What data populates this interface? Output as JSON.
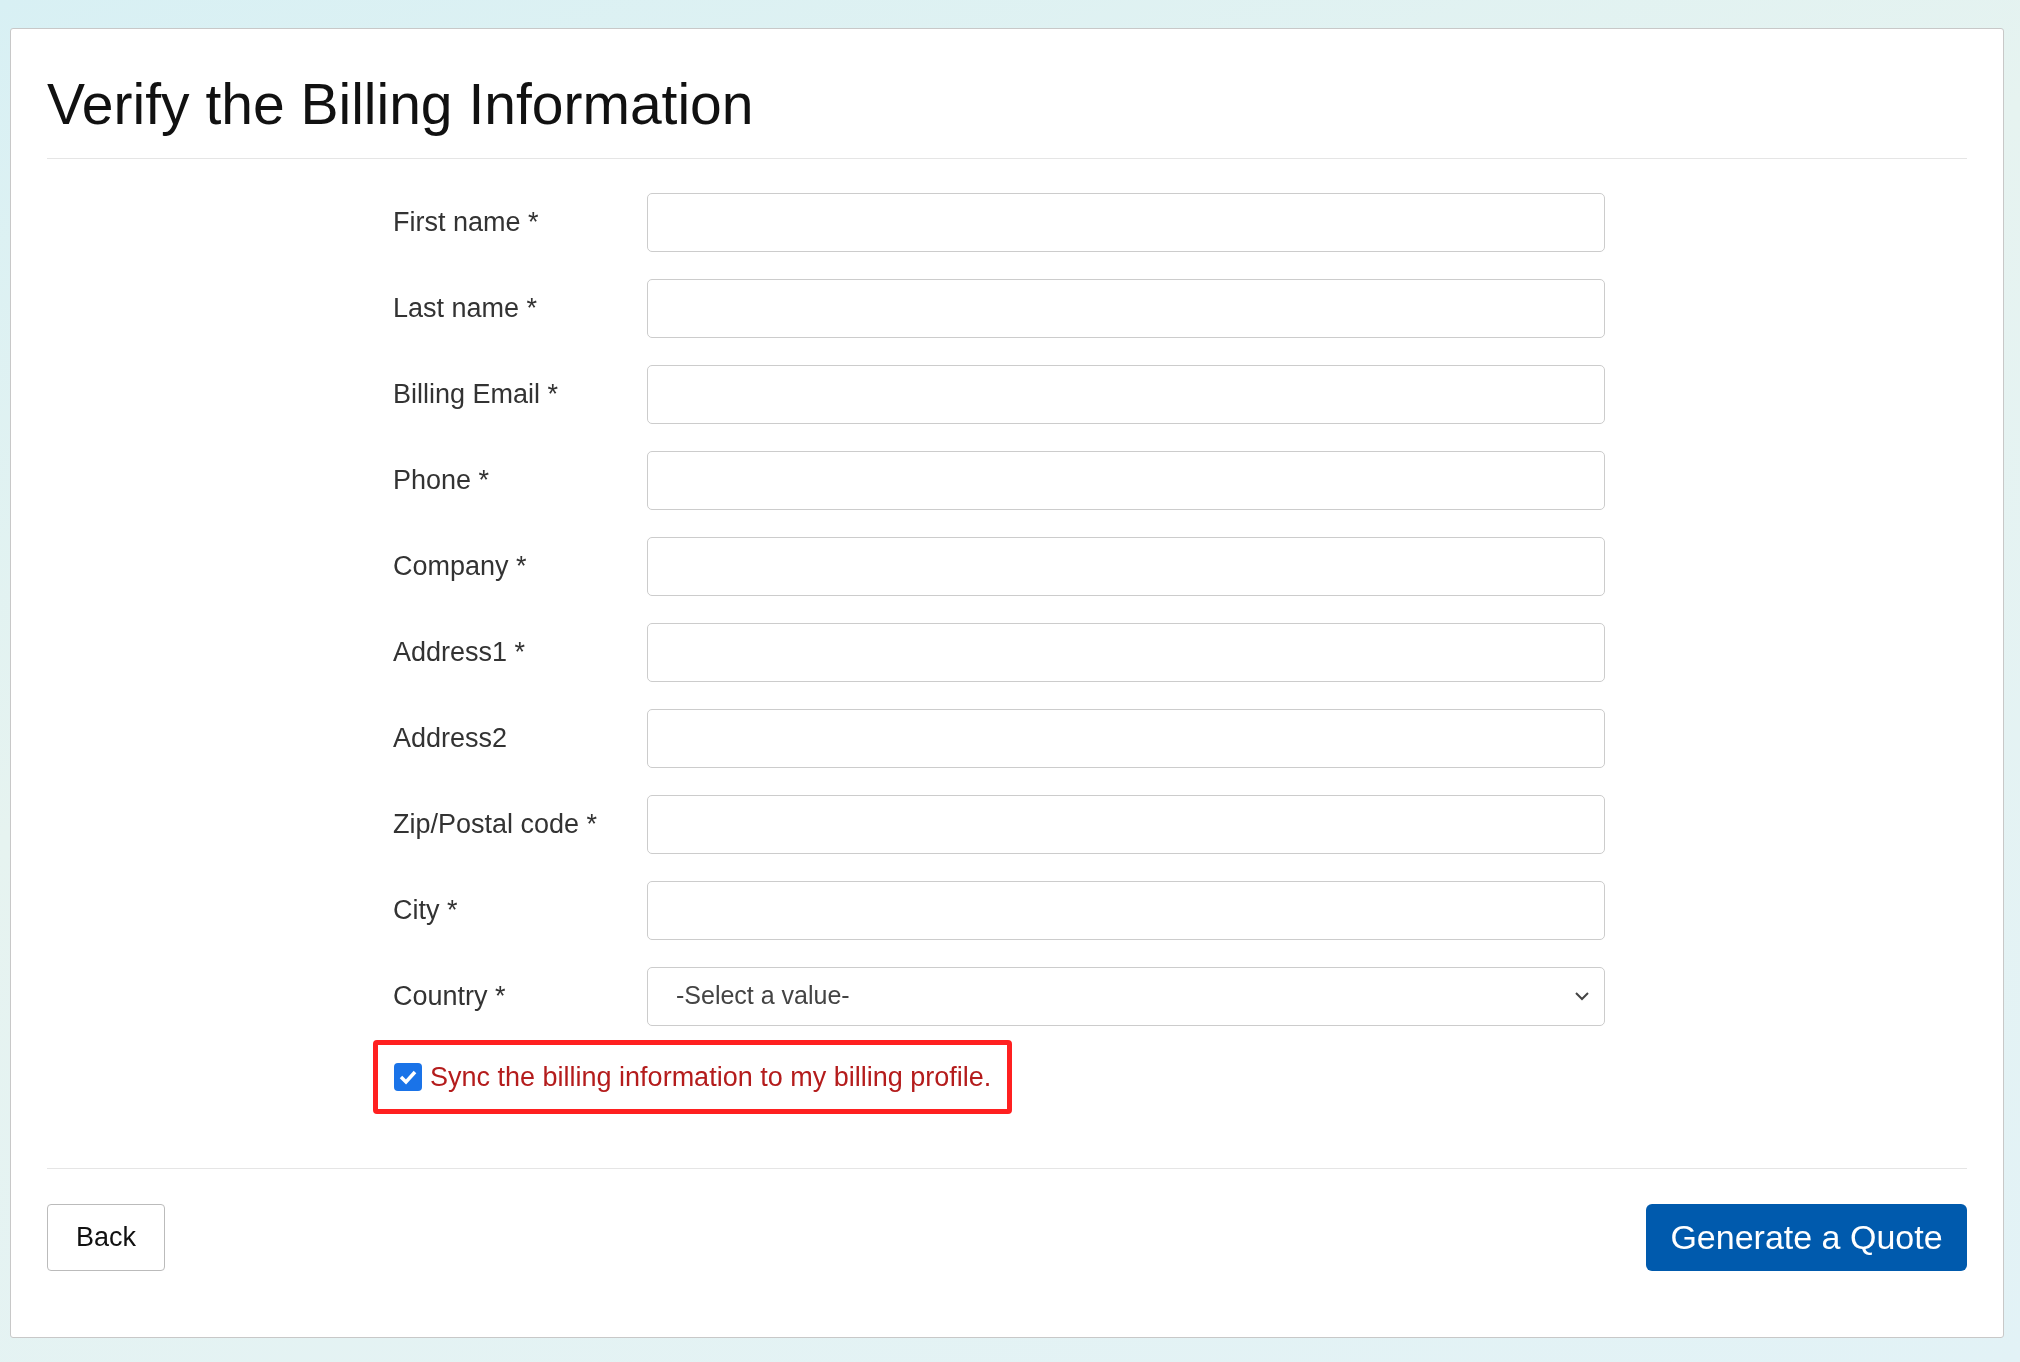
{
  "title": "Verify the Billing Information",
  "fields": [
    {
      "kind": "text",
      "label": "First name *"
    },
    {
      "kind": "text",
      "label": "Last name *"
    },
    {
      "kind": "text",
      "label": "Billing Email *"
    },
    {
      "kind": "text",
      "label": "Phone *"
    },
    {
      "kind": "text",
      "label": "Company *"
    },
    {
      "kind": "text",
      "label": "Address1 *"
    },
    {
      "kind": "text",
      "label": "Address2"
    },
    {
      "kind": "text",
      "label": "Zip/Postal code *"
    },
    {
      "kind": "text",
      "label": "City *"
    },
    {
      "kind": "select",
      "label": "Country *",
      "value": "-Select a value-"
    }
  ],
  "sync": {
    "label": "Sync the billing information to my billing profile.",
    "checked": true,
    "highlighted": true
  },
  "buttons": {
    "back": "Back",
    "submit": "Generate a Quote"
  }
}
